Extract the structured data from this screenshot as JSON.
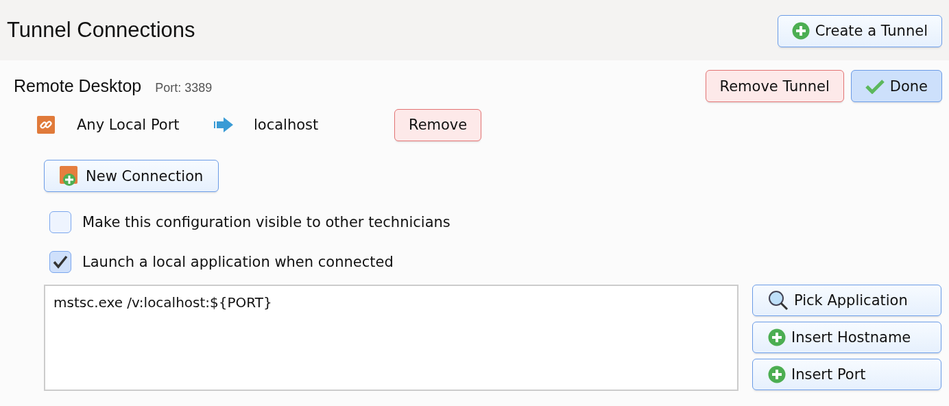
{
  "header": {
    "title": "Tunnel Connections",
    "action": {
      "label": "Create a Tunnel",
      "kind": "add"
    }
  },
  "tunnel": {
    "name": "Remote Desktop",
    "port": "Port: 3389",
    "actions": [
      {
        "label": "Remove Tunnel",
        "kind": "remove"
      },
      {
        "label": "Done",
        "kind": "confirm"
      }
    ],
    "connections": [
      {
        "source": "Any Local Port",
        "target": "localhost",
        "remove": {
          "label": "Remove",
          "kind": "remove"
        }
      }
    ],
    "new_connection": {
      "label": "New Connection",
      "kind": "connect"
    },
    "options": [
      {
        "label": "Make this configuration visible to other technicians",
        "checked": false
      },
      {
        "label": "Launch a local application when connected",
        "checked": true
      }
    ],
    "command": {
      "value": "mstsc.exe /v:localhost:${PORT}"
    },
    "command_buttons": [
      {
        "label": "Pick Application",
        "kind": "pick"
      },
      {
        "label": "Insert Hostname",
        "kind": "add"
      },
      {
        "label": "Insert Port",
        "kind": "add"
      }
    ]
  }
}
